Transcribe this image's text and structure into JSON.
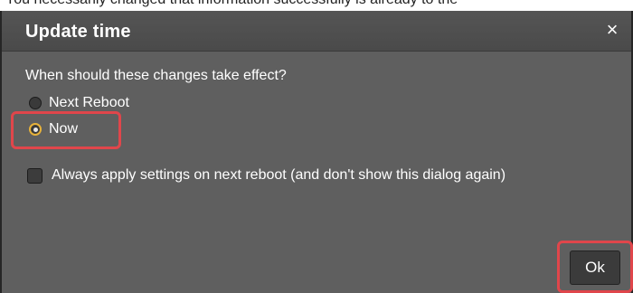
{
  "top_caption": "You necessarily changed that information successfully is already to the",
  "dialog": {
    "title": "Update time",
    "close_icon": "close-icon",
    "question": "When should these changes take effect?",
    "options": [
      {
        "label": "Next Reboot",
        "selected": false
      },
      {
        "label": "Now",
        "selected": true
      }
    ],
    "checkbox": {
      "label": "Always apply settings on next reboot (and don't show this dialog again)",
      "checked": false
    },
    "ok_label": "Ok"
  },
  "colors": {
    "dialog_bg": "#5f5f5f",
    "titlebar_bg": "#4a4a4a",
    "radio_selected_ring": "#e7b23a",
    "highlight_box": "#e0464b"
  }
}
